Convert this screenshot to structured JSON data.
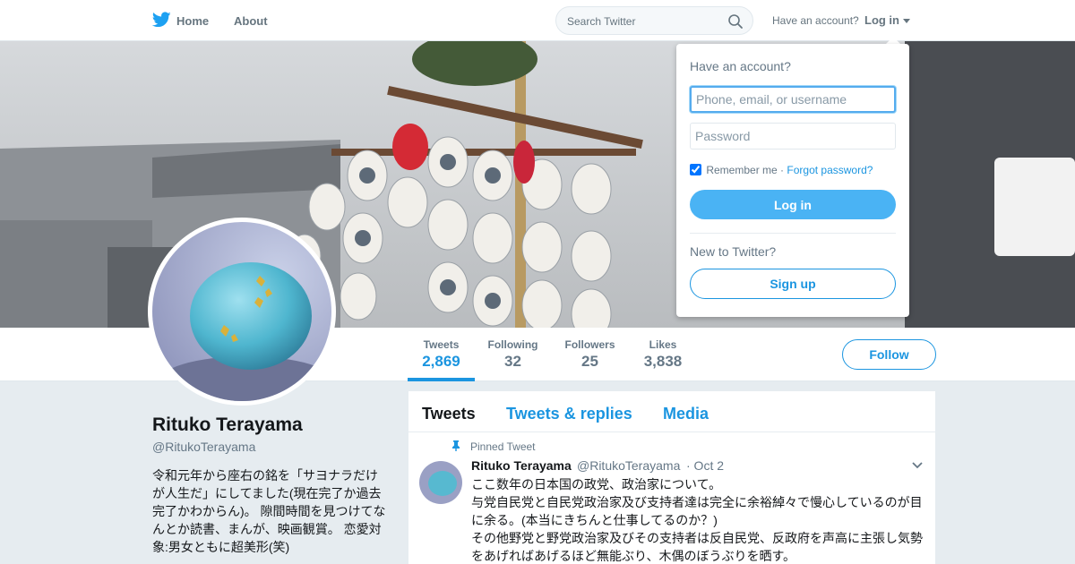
{
  "nav": {
    "home_label": "Home",
    "about_label": "About",
    "search_placeholder": "Search Twitter",
    "have_account": "Have an account?",
    "login_label": "Log in"
  },
  "profile": {
    "name": "Rituko Terayama",
    "handle": "@RitukoTerayama",
    "bio": "令和元年から座右の銘を「サヨナラだけが人生だ」にしてました(現在完了か過去完了かわからん)。 隙間時間を見つけてなんとか読書、まんが、映画観賞。 恋愛対象:男女ともに超美形(笑)"
  },
  "stats": [
    {
      "label": "Tweets",
      "value": "2,869"
    },
    {
      "label": "Following",
      "value": "32"
    },
    {
      "label": "Followers",
      "value": "25"
    },
    {
      "label": "Likes",
      "value": "3,838"
    }
  ],
  "follow_label": "Follow",
  "tabs": [
    "Tweets",
    "Tweets & replies",
    "Media"
  ],
  "tweet": {
    "pinned_label": "Pinned Tweet",
    "name": "Rituko Terayama",
    "handle": "@RitukoTerayama",
    "date": "· Oct 2",
    "lines": [
      "ここ数年の日本国の政党、政治家について。",
      "与党自民党と自民党政治家及び支持者達は完全に余裕綽々で慢心しているのが目に余る。(本当にきちんと仕事してるのか？)",
      "その他野党と野党政治家及びその支持者は反自民党、反政府を声高に主張し気勢をあげればあげるほど無能ぶり、木偶のぼうぶりを晒す。"
    ]
  },
  "login_dropdown": {
    "title": "Have an account?",
    "username_placeholder": "Phone, email, or username",
    "password_placeholder": "Password",
    "remember_label": "Remember me",
    "forgot_label": "Forgot password?",
    "login_button": "Log in",
    "new_label": "New to Twitter?",
    "signup_button": "Sign up"
  },
  "colors": {
    "accent": "#1b95e0",
    "button_blue": "#4ab3f4",
    "background": "#e6ecf0"
  }
}
